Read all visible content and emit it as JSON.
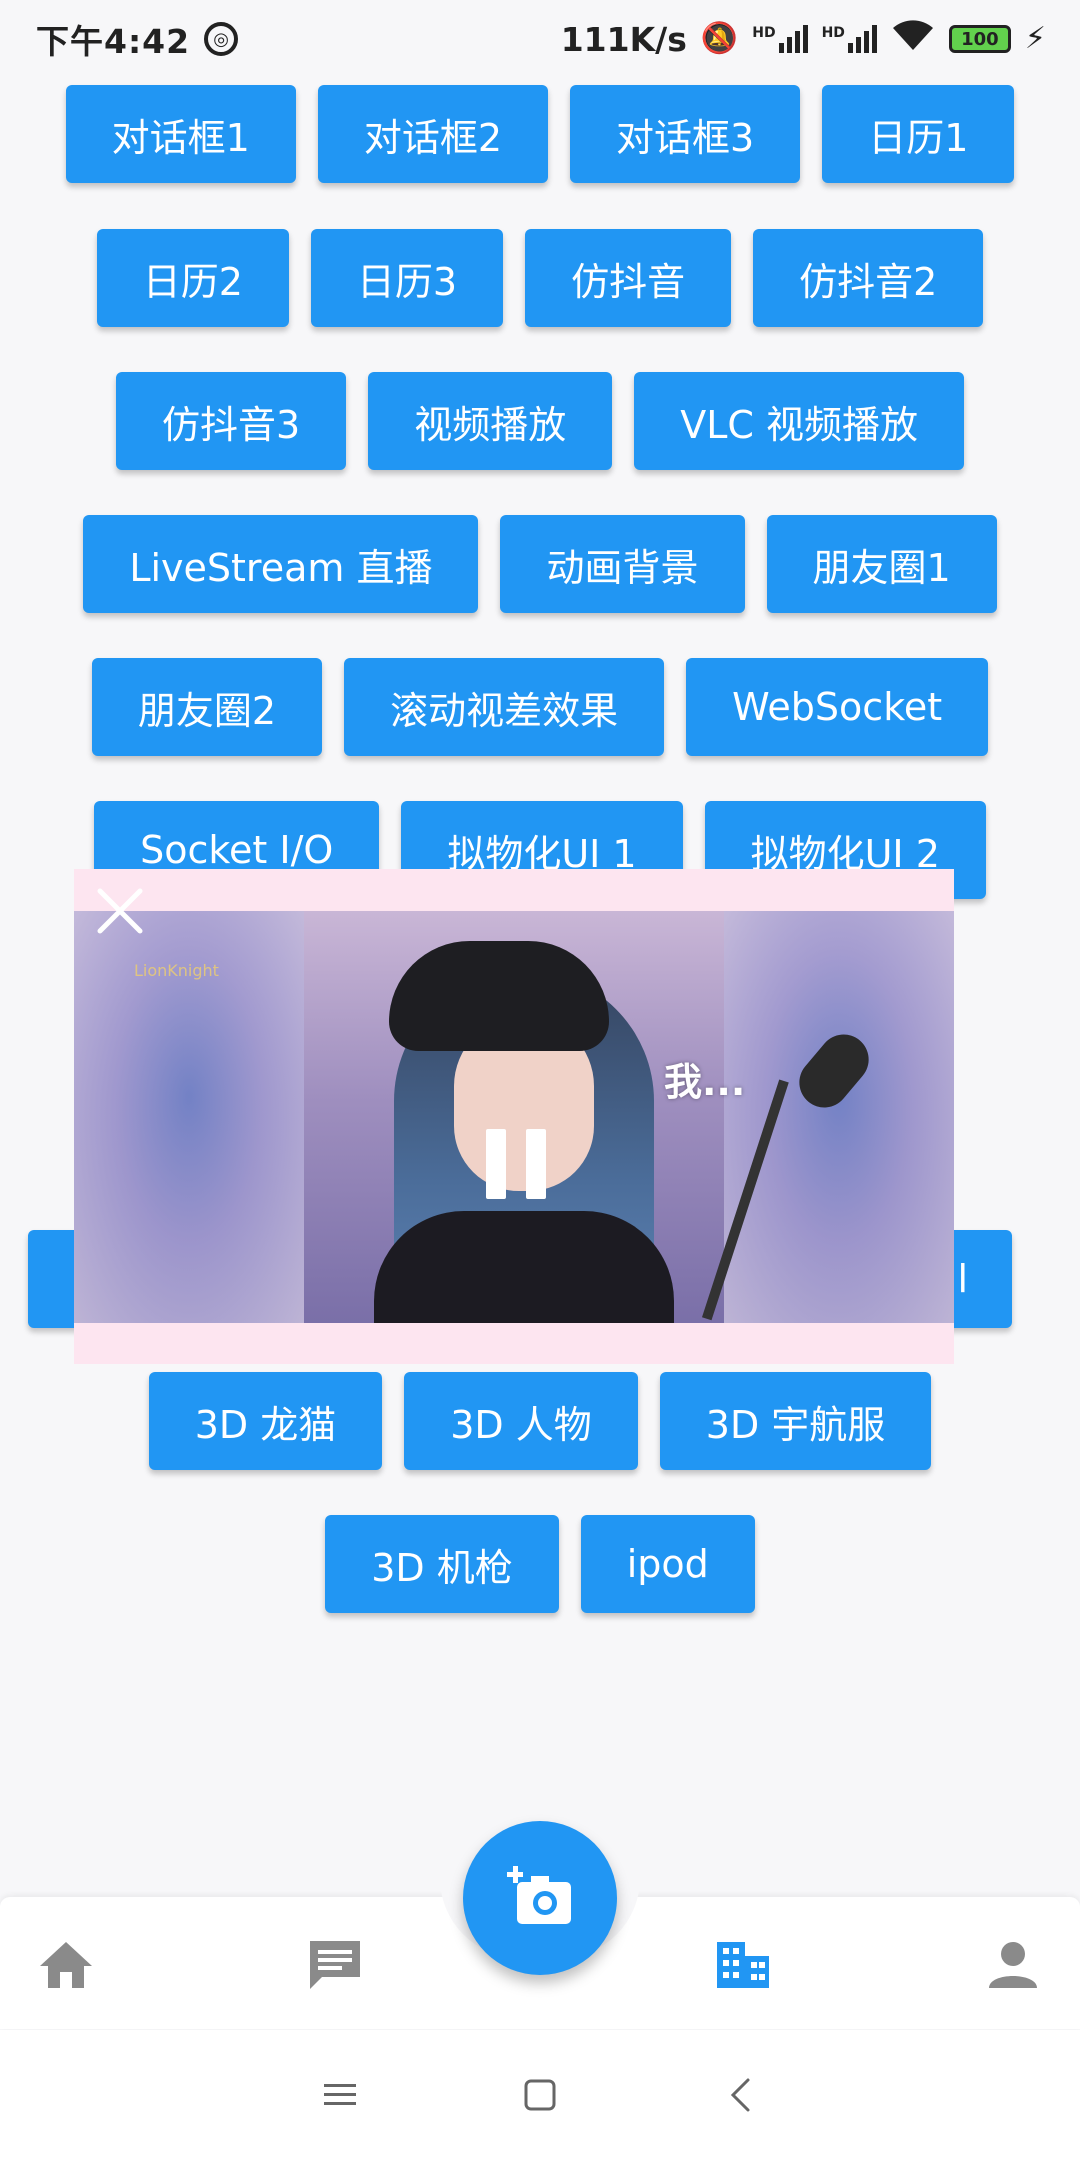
{
  "status_bar": {
    "time": "下午4:42",
    "net_speed": "111K/s",
    "hd1": "HD",
    "hd2": "HD",
    "battery": "100"
  },
  "buttons": {
    "row1": [
      "对话框1",
      "对话框2",
      "对话框3",
      "日历1"
    ],
    "row2": [
      "日历2",
      "日历3",
      "仿抖音",
      "仿抖音2"
    ],
    "row3": [
      "仿抖音3",
      "视频播放",
      "VLC 视频播放"
    ],
    "row4": [
      "LiveStream 直播",
      "动画背景",
      "朋友圈1"
    ],
    "row5": [
      "朋友圈2",
      "滚动视差效果",
      "WebSocket"
    ],
    "row6": [
      "Socket I/O",
      "拟物化UI 1",
      "拟物化UI 2"
    ],
    "row7_partial_right": "l",
    "row8": [
      "3D 龙猫",
      "3D 人物",
      "3D 宇航服"
    ],
    "row9": [
      "3D 机枪",
      "ipod"
    ]
  },
  "video": {
    "subtitle": "我...",
    "watermark": "LionKnight"
  },
  "bottom_nav": {
    "items": [
      "home-icon",
      "chat-icon",
      "add-photo-icon",
      "business-icon",
      "person-icon"
    ],
    "active_color": "#2196f3",
    "inactive_color": "#8a8a8a"
  },
  "colors": {
    "primary": "#2196f3",
    "background": "#f7f7f9"
  }
}
